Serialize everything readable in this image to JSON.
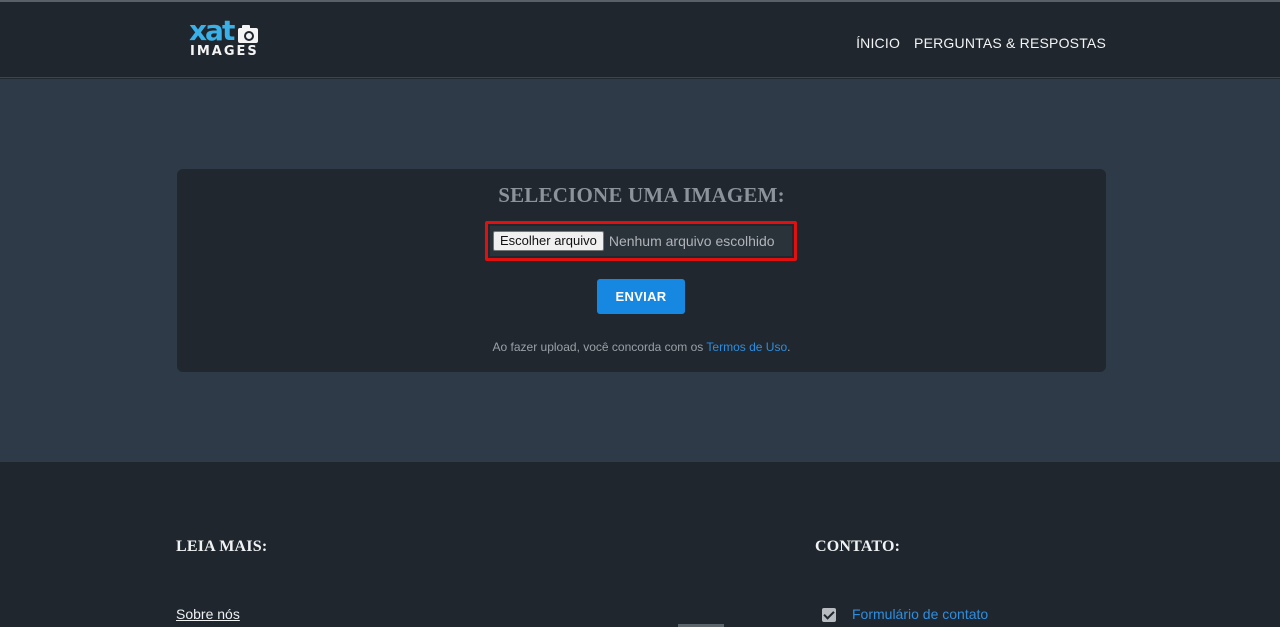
{
  "header": {
    "logo": {
      "top": "xat",
      "bottom": "IMAGES",
      "icon": "camera-icon"
    },
    "nav": [
      {
        "label": "ÍNICIO"
      },
      {
        "label": "PERGUNTAS & RESPOSTAS"
      }
    ]
  },
  "upload": {
    "title": "SELECIONE UMA IMAGEM:",
    "file_button_label": "Escolher arquivo",
    "file_status": "Nenhum arquivo escolhido",
    "submit_label": "ENVIAR",
    "terms_prefix": "Ao fazer upload, você concorda com os ",
    "terms_link": "Termos de Uso",
    "terms_suffix": "."
  },
  "footer": {
    "read_more_title": "LEIA MAIS:",
    "read_more_links": [
      "Sobre nós"
    ],
    "contact_title": "CONTATO:",
    "contact_link": "Formulário de contato",
    "contact_icon": "check-square-icon"
  },
  "colors": {
    "accent": "#1688e2",
    "link": "#2d8ee0",
    "highlight_border": "#e01010",
    "header_bg": "#1f262d",
    "hero_bg": "#2e3a47"
  }
}
